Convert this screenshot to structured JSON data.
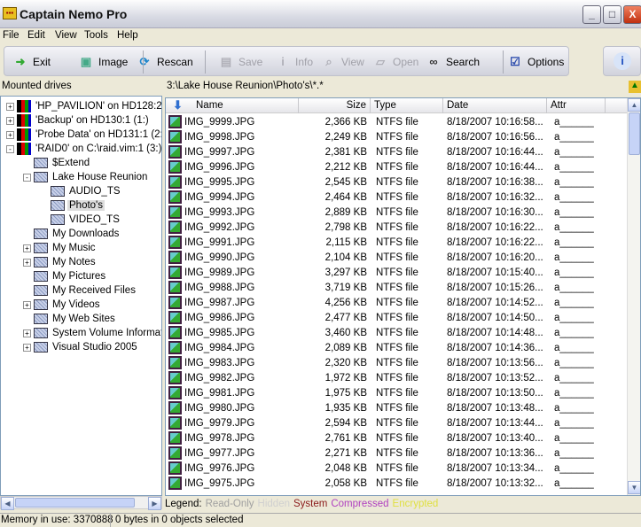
{
  "window": {
    "title": "Captain Nemo Pro",
    "icon": "app-icon",
    "controls": [
      "_",
      "□",
      "X"
    ]
  },
  "menu": [
    "File",
    "Edit",
    "View",
    "Tools",
    "Help"
  ],
  "toolbar": [
    {
      "label": "Exit",
      "icon": "exit-door-icon",
      "enabled": true
    },
    {
      "label": "Image",
      "icon": "image-icon",
      "enabled": true
    },
    {
      "label": "Rescan",
      "icon": "rescan-icon",
      "enabled": true
    },
    {
      "label": "Save",
      "icon": "floppy-icon",
      "enabled": false
    },
    {
      "label": "Info",
      "icon": "info-icon",
      "enabled": false
    },
    {
      "label": "View",
      "icon": "magnifier-icon",
      "enabled": false
    },
    {
      "label": "Open",
      "icon": "folder-open-icon",
      "enabled": false
    },
    {
      "label": "Search",
      "icon": "binoculars-icon",
      "enabled": true
    },
    {
      "label": "Options",
      "icon": "checklist-icon",
      "enabled": true
    }
  ],
  "labels": {
    "drives": "Mounted drives",
    "path": "3:\\Lake House Reunion\\Photo's\\*.*"
  },
  "tree": [
    {
      "label": "'HP_PAVILION' on HD128:2 (",
      "level": 0,
      "type": "drive",
      "expander": "+"
    },
    {
      "label": "'Backup' on HD130:1 (1:)",
      "level": 0,
      "type": "drive",
      "expander": "+"
    },
    {
      "label": "'Probe Data' on HD131:1 (2:)",
      "level": 0,
      "type": "drive",
      "expander": "+"
    },
    {
      "label": "'RAID0' on C:\\raid.vim:1 (3:)",
      "level": 0,
      "type": "drive",
      "expander": "-"
    },
    {
      "label": "$Extend",
      "level": 1,
      "type": "folder",
      "expander": ""
    },
    {
      "label": "Lake House Reunion",
      "level": 1,
      "type": "folder",
      "expander": "-"
    },
    {
      "label": "AUDIO_TS",
      "level": 2,
      "type": "folder",
      "expander": ""
    },
    {
      "label": "Photo's",
      "level": 2,
      "type": "folder",
      "expander": "",
      "selected": true
    },
    {
      "label": "VIDEO_TS",
      "level": 2,
      "type": "folder",
      "expander": ""
    },
    {
      "label": "My Downloads",
      "level": 1,
      "type": "folder",
      "expander": ""
    },
    {
      "label": "My Music",
      "level": 1,
      "type": "folder",
      "expander": "+"
    },
    {
      "label": "My Notes",
      "level": 1,
      "type": "folder",
      "expander": "+"
    },
    {
      "label": "My Pictures",
      "level": 1,
      "type": "folder",
      "expander": ""
    },
    {
      "label": "My Received Files",
      "level": 1,
      "type": "folder",
      "expander": ""
    },
    {
      "label": "My Videos",
      "level": 1,
      "type": "folder",
      "expander": "+"
    },
    {
      "label": "My Web Sites",
      "level": 1,
      "type": "folder",
      "expander": ""
    },
    {
      "label": "System Volume Informatio",
      "level": 1,
      "type": "folder",
      "expander": "+"
    },
    {
      "label": "Visual Studio 2005",
      "level": 1,
      "type": "folder",
      "expander": "+"
    }
  ],
  "columns": [
    "Name",
    "Size",
    "Type",
    "Date",
    "Attr"
  ],
  "files": [
    [
      "IMG_9999.JPG",
      "2,366 KB",
      "NTFS file",
      "8/18/2007 10:16:58...",
      "a______"
    ],
    [
      "IMG_9998.JPG",
      "2,249 KB",
      "NTFS file",
      "8/18/2007 10:16:56...",
      "a______"
    ],
    [
      "IMG_9997.JPG",
      "2,381 KB",
      "NTFS file",
      "8/18/2007 10:16:44...",
      "a______"
    ],
    [
      "IMG_9996.JPG",
      "2,212 KB",
      "NTFS file",
      "8/18/2007 10:16:44...",
      "a______"
    ],
    [
      "IMG_9995.JPG",
      "2,545 KB",
      "NTFS file",
      "8/18/2007 10:16:38...",
      "a______"
    ],
    [
      "IMG_9994.JPG",
      "2,464 KB",
      "NTFS file",
      "8/18/2007 10:16:32...",
      "a______"
    ],
    [
      "IMG_9993.JPG",
      "2,889 KB",
      "NTFS file",
      "8/18/2007 10:16:30...",
      "a______"
    ],
    [
      "IMG_9992.JPG",
      "2,798 KB",
      "NTFS file",
      "8/18/2007 10:16:22...",
      "a______"
    ],
    [
      "IMG_9991.JPG",
      "2,115 KB",
      "NTFS file",
      "8/18/2007 10:16:22...",
      "a______"
    ],
    [
      "IMG_9990.JPG",
      "2,104 KB",
      "NTFS file",
      "8/18/2007 10:16:20...",
      "a______"
    ],
    [
      "IMG_9989.JPG",
      "3,297 KB",
      "NTFS file",
      "8/18/2007 10:15:40...",
      "a______"
    ],
    [
      "IMG_9988.JPG",
      "3,719 KB",
      "NTFS file",
      "8/18/2007 10:15:26...",
      "a______"
    ],
    [
      "IMG_9987.JPG",
      "4,256 KB",
      "NTFS file",
      "8/18/2007 10:14:52...",
      "a______"
    ],
    [
      "IMG_9986.JPG",
      "2,477 KB",
      "NTFS file",
      "8/18/2007 10:14:50...",
      "a______"
    ],
    [
      "IMG_9985.JPG",
      "3,460 KB",
      "NTFS file",
      "8/18/2007 10:14:48...",
      "a______"
    ],
    [
      "IMG_9984.JPG",
      "2,089 KB",
      "NTFS file",
      "8/18/2007 10:14:36...",
      "a______"
    ],
    [
      "IMG_9983.JPG",
      "2,320 KB",
      "NTFS file",
      "8/18/2007 10:13:56...",
      "a______"
    ],
    [
      "IMG_9982.JPG",
      "1,972 KB",
      "NTFS file",
      "8/18/2007 10:13:52...",
      "a______"
    ],
    [
      "IMG_9981.JPG",
      "1,975 KB",
      "NTFS file",
      "8/18/2007 10:13:50...",
      "a______"
    ],
    [
      "IMG_9980.JPG",
      "1,935 KB",
      "NTFS file",
      "8/18/2007 10:13:48...",
      "a______"
    ],
    [
      "IMG_9979.JPG",
      "2,594 KB",
      "NTFS file",
      "8/18/2007 10:13:44...",
      "a______"
    ],
    [
      "IMG_9978.JPG",
      "2,761 KB",
      "NTFS file",
      "8/18/2007 10:13:40...",
      "a______"
    ],
    [
      "IMG_9977.JPG",
      "2,271 KB",
      "NTFS file",
      "8/18/2007 10:13:36...",
      "a______"
    ],
    [
      "IMG_9976.JPG",
      "2,048 KB",
      "NTFS file",
      "8/18/2007 10:13:34...",
      "a______"
    ],
    [
      "IMG_9975.JPG",
      "2,058 KB",
      "NTFS file",
      "8/18/2007 10:13:32...",
      "a______"
    ]
  ],
  "legend": {
    "label": "Legend:",
    "items": [
      {
        "text": "Read-Only",
        "color": "#a0a0a0"
      },
      {
        "text": "Hidden",
        "color": "#d0d0d0"
      },
      {
        "text": "System",
        "color": "#8b1a1a"
      },
      {
        "text": "Compressed",
        "color": "#b040c0"
      },
      {
        "text": "Encrypted",
        "color": "#e0e040"
      }
    ]
  },
  "status": {
    "memory": "Memory in use: 3370888",
    "selection": "0 bytes in 0 objects selected"
  }
}
